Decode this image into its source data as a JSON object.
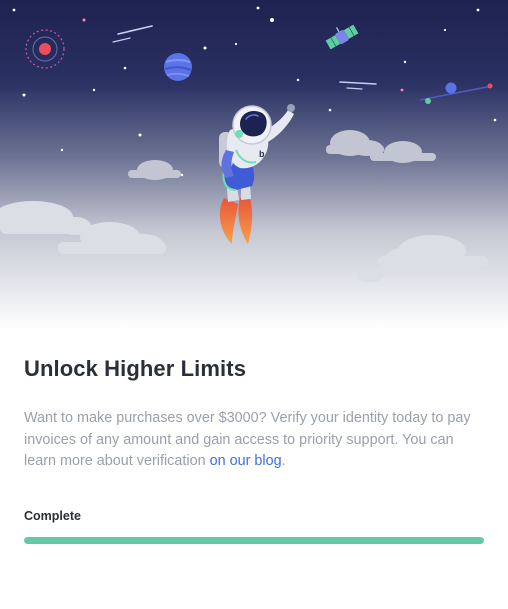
{
  "card": {
    "title": "Unlock Higher Limits",
    "body_text": "Want to make purchases over $3000? Verify your identity today to pay invoices of any amount and gain access to priority support. You can learn more about verification ",
    "link_text": "on our blog",
    "link_suffix": "."
  },
  "progress": {
    "label": "Complete",
    "percent": 100,
    "color": "#61c9a3"
  },
  "illustration": {
    "sky_top_color": "#1e2250",
    "sky_bottom_color": "#ffffff",
    "items": [
      "stars",
      "red-planet-icon",
      "blue-planet-icon",
      "satellite-icon",
      "astronaut-icon",
      "clouds"
    ]
  }
}
